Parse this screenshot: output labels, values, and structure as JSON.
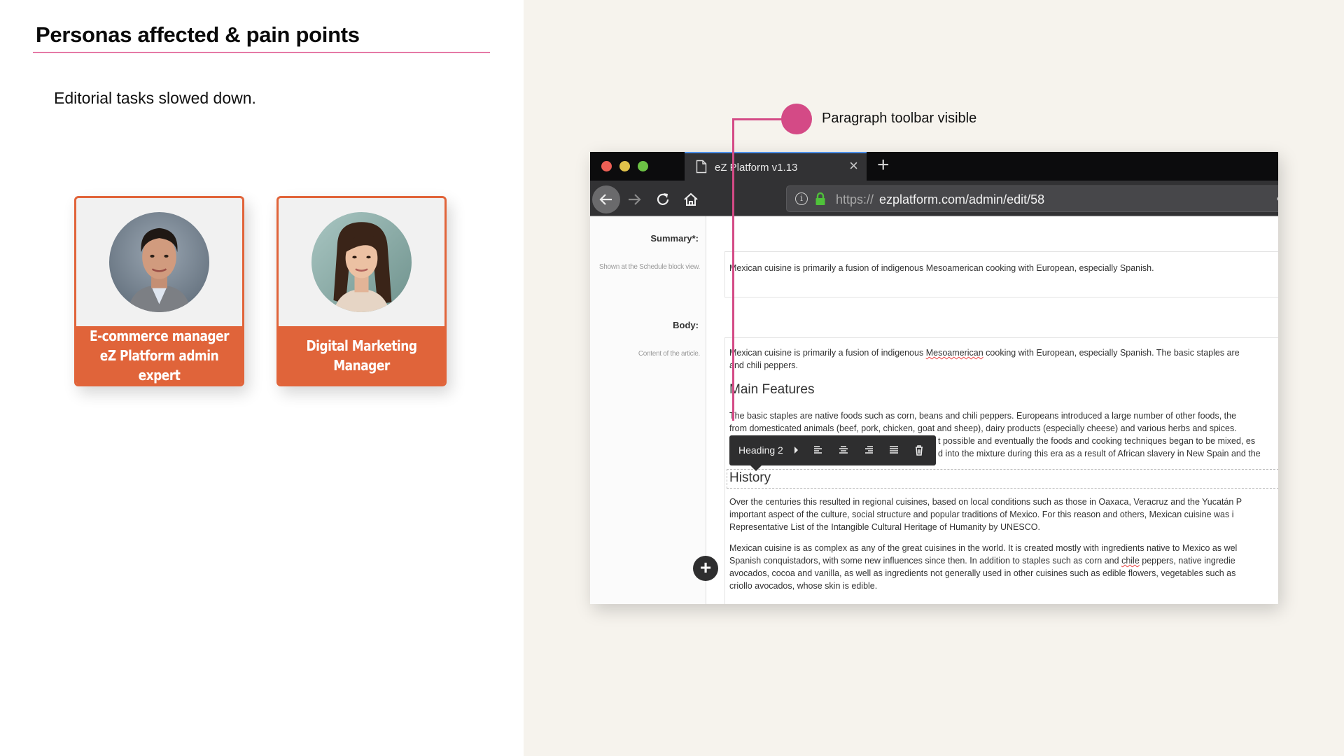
{
  "slide": {
    "title": "Personas affected & pain points",
    "subtitle": "Editorial tasks slowed down.",
    "accent_color": "#e57aa6",
    "personas": [
      {
        "line1": "E-commerce manager",
        "line2": "eZ Platform admin expert",
        "avatar": "man-portrait"
      },
      {
        "line1": "Digital Marketing",
        "line2": "Manager",
        "avatar": "woman-portrait"
      }
    ],
    "persona_color": "#e0643a"
  },
  "callout": {
    "label": "Paragraph toolbar visible",
    "color": "#d44a86"
  },
  "browser": {
    "tab_title": "eZ Platform v1.13",
    "tab_close": "×",
    "new_tab": "+",
    "url_scheme": "https://",
    "url_host": "ezplatform.com/admin/edit/58",
    "url_more": "••",
    "info_glyph": "i"
  },
  "editor": {
    "summary": {
      "label": "Summary*:",
      "hint": "Shown at the Schedule block view.",
      "value": "Mexican cuisine is primarily a fusion of indigenous Mesoamerican cooking with European, especially Spanish."
    },
    "body": {
      "label": "Body:",
      "hint": "Content of the article.",
      "intro_line1_a": "Mexican cuisine is primarily a fusion of indigenous ",
      "intro_line1_spell": "Mesoamerican",
      "intro_line1_b": " cooking with European, especially Spanish. The basic staples are",
      "intro_line2": "and chili peppers.",
      "heading_main": "Main Features",
      "features_line1": "The basic staples are native foods such as corn, beans and chili peppers. Europeans introduced a large number of other foods, the",
      "features_line2": "from domesticated animals (beef, pork, chicken, goat and sheep), dairy products (especially cheese) and various herbs and spices.",
      "features_line3": "t possible and eventually the foods and cooking techniques began to be mixed, es",
      "features_line4": "d into the mixture during this era as a result of African slavery in New Spain and the",
      "heading_history": "History",
      "history_p1": [
        "Over the centuries this resulted in regional cuisines, based on local conditions such as those in Oaxaca, Veracruz and the Yucatán P",
        "important aspect of the culture, social structure and popular traditions of Mexico. For this reason and others, Mexican cuisine was i",
        "Representative List of the Intangible Cultural Heritage of Humanity by UNESCO."
      ],
      "history_p2_line1": "Mexican cuisine is as complex as any of the great cuisines in the world. It is created mostly with ingredients native to Mexico as wel",
      "history_p2_line2_a": "Spanish conquistadors, with some new influences since then. In addition to staples such as corn and ",
      "history_p2_line2_spell": "chile",
      "history_p2_line2_b": " peppers, native ingredie",
      "history_p2_line3": "avocados, cocoa and vanilla, as well as ingredients not generally used in other cuisines such as edible flowers, vegetables such as",
      "history_p2_line4": "criollo avocados, whose skin is edible."
    },
    "toolbar": {
      "style_label": "Heading 2",
      "buttons": [
        "align-left",
        "align-center",
        "align-right",
        "justify",
        "delete"
      ]
    },
    "add_button": "+"
  }
}
